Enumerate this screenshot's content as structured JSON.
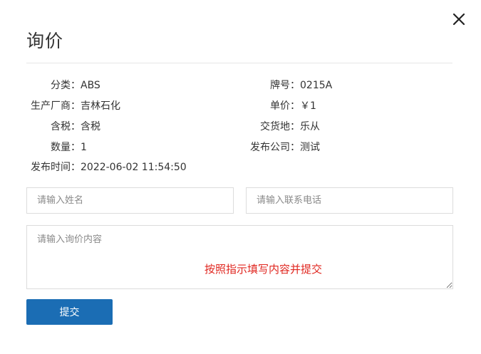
{
  "dialog": {
    "title": "询价",
    "close_icon": "close-icon"
  },
  "info": {
    "left": [
      {
        "label": "分类：",
        "value": "ABS"
      },
      {
        "label": "生产厂商：",
        "value": "吉林石化"
      },
      {
        "label": "含税：",
        "value": "含税"
      },
      {
        "label": "数量：",
        "value": "1"
      },
      {
        "label": "发布时间：",
        "value": "2022-06-02 11:54:50"
      }
    ],
    "right": [
      {
        "label": "牌号：",
        "value": "0215A"
      },
      {
        "label": "单价：",
        "value": "￥1"
      },
      {
        "label": "交货地：",
        "value": "乐从"
      },
      {
        "label": "发布公司：",
        "value": "测试"
      }
    ]
  },
  "form": {
    "name_placeholder": "请输入姓名",
    "phone_placeholder": "请输入联系电话",
    "content_placeholder": "请输入询价内容",
    "hint": "按照指示填写内容并提交",
    "submit_label": "提交"
  },
  "colors": {
    "primary": "#1b6db4",
    "hint": "#e0261f",
    "border": "#dcdcdc"
  }
}
